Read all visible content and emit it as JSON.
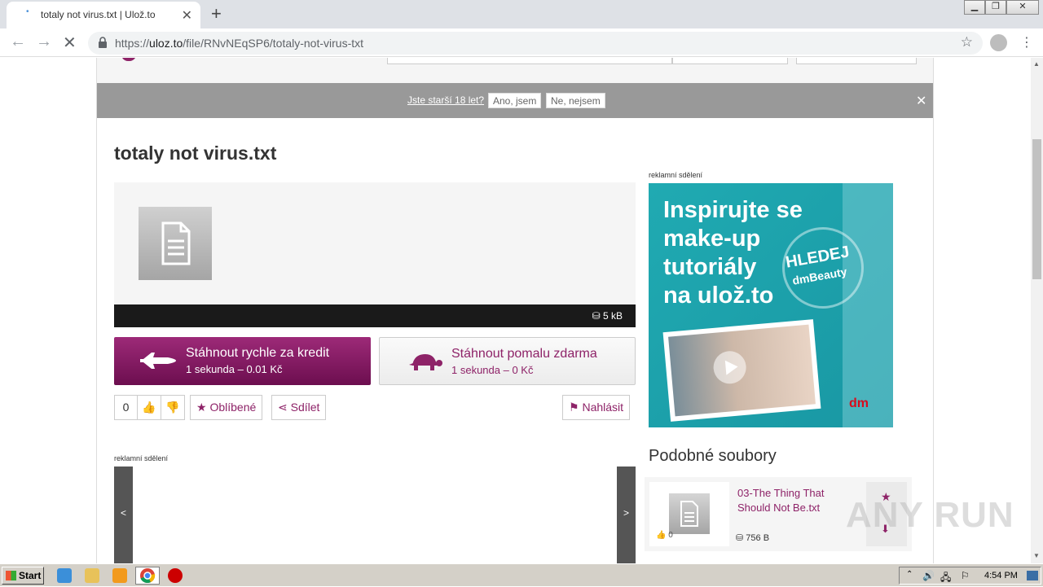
{
  "browser": {
    "tab_title": "totaly not virus.txt | Ulož.to",
    "url_prefix": "https://",
    "url_domain": "uloz.to",
    "url_path": "/file/RNvNEqSP6/totaly-not-virus-txt"
  },
  "age_bar": {
    "question": "Jste starší 18 let?",
    "yes": "Ano, jsem",
    "no": "Ne, nejsem"
  },
  "file": {
    "title": "totaly not virus.txt",
    "size": "5 kB"
  },
  "download": {
    "fast_title": "Stáhnout rychle za kredit",
    "fast_sub": "1 sekunda – 0.01 Kč",
    "slow_title": "Stáhnout pomalu zdarma",
    "slow_sub": "1 sekunda – 0 Kč"
  },
  "actions": {
    "rating": "0",
    "favorite": "Oblíbené",
    "share": "Sdílet",
    "report": "Nahlásit"
  },
  "ad_label": "reklamní sdělení",
  "ad": {
    "headline": "Inspirujte se\nmake-up\ntutoriály\nna ulož.to",
    "hledej": "HLEDEJ",
    "dmbeauty": "dmBeauty",
    "brand": "dm"
  },
  "carousel": {
    "prev": "<",
    "next": ">"
  },
  "similar": {
    "heading": "Podobné soubory",
    "items": [
      {
        "title": "03-The Thing That Should Not Be.txt",
        "size": "756 B",
        "likes": "0"
      }
    ]
  },
  "watermark": "ANY RUN",
  "taskbar": {
    "start": "Start",
    "clock": "4:54 PM"
  },
  "colors": {
    "brand": "#8e2368",
    "ad_teal": "#20aab2"
  }
}
